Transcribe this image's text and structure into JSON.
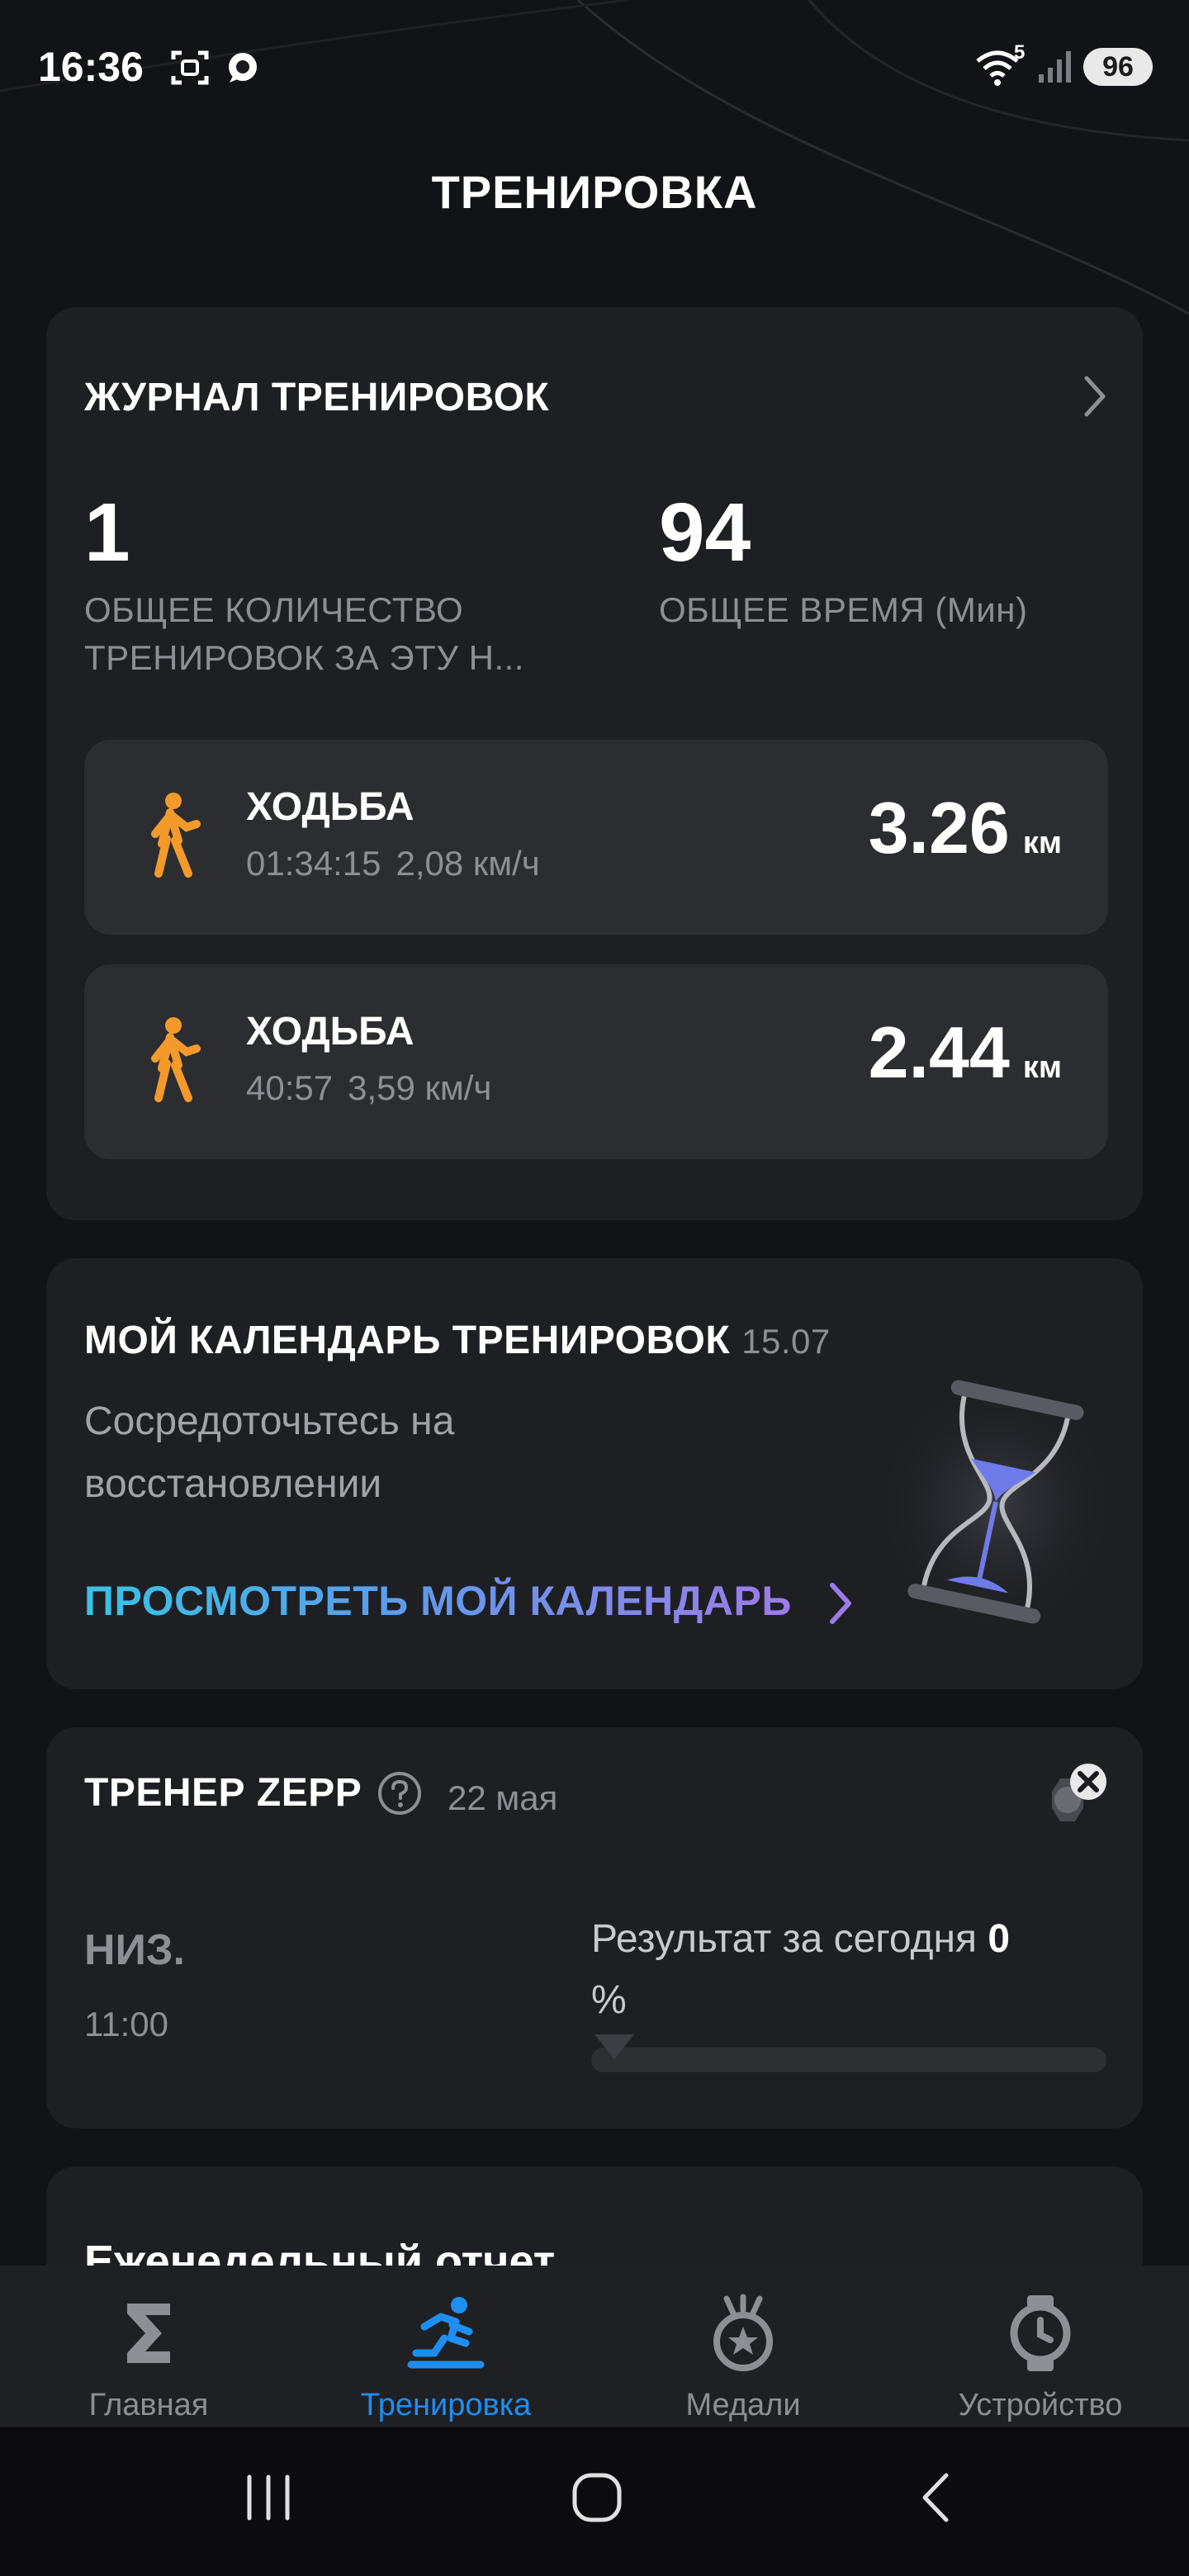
{
  "status_bar": {
    "time": "16:36",
    "network_badge": "5",
    "battery": "96"
  },
  "header": {
    "title": "ТРЕНИРОВКА"
  },
  "workout_log": {
    "title": "ЖУРНАЛ ТРЕНИРОВОК",
    "total_count_value": "1",
    "total_count_label_1": "ОБЩЕЕ КОЛИЧЕСТВО",
    "total_count_label_2": "ТРЕНИРОВОК ЗА ЭТУ Н...",
    "total_time_value": "94",
    "total_time_label": "ОБЩЕЕ ВРЕМЯ (Мин)",
    "workouts": [
      {
        "name": "ХОДЬБА",
        "duration": "01:34:15",
        "pace": "2,08 км/ч",
        "distance": "3.26",
        "unit": "км",
        "icon": "walking-icon"
      },
      {
        "name": "ХОДЬБА",
        "duration": "40:57",
        "pace": "3,59 км/ч",
        "distance": "2.44",
        "unit": "км",
        "icon": "walking-icon"
      }
    ]
  },
  "calendar": {
    "title": "МОЙ КАЛЕНДАРЬ ТРЕНИРОВОК",
    "date": "15.07",
    "body_line_1": "Сосредоточьтесь на",
    "body_line_2": "восстановлении",
    "link": "ПРОСМОТРЕТЬ МОЙ КАЛЕНДАРЬ",
    "image": "hourglass-icon"
  },
  "coach": {
    "title": "ТРЕНЕР ZEPP",
    "date": "22 мая",
    "level": "НИЗ.",
    "time": "11:00",
    "result_label": "Результат за сегодня",
    "result_value": "0",
    "result_unit": "%",
    "progress_fraction": 0
  },
  "weekly_report": {
    "title": "Еженедельный отчет"
  },
  "bottom_nav": {
    "items": [
      {
        "label": "Главная",
        "icon": "sigma-icon",
        "active": false
      },
      {
        "label": "Тренировка",
        "icon": "running-icon",
        "active": true
      },
      {
        "label": "Медали",
        "icon": "medal-icon",
        "active": false
      },
      {
        "label": "Устройство",
        "icon": "watch-icon",
        "active": false
      }
    ]
  },
  "colors": {
    "background": "#121316",
    "card": "#1e1f23",
    "workout_tile": "#2c2d31",
    "accent_orange": "#f39a2b",
    "active_blue": "#1e8ff0",
    "muted_text": "#8e8f94"
  }
}
